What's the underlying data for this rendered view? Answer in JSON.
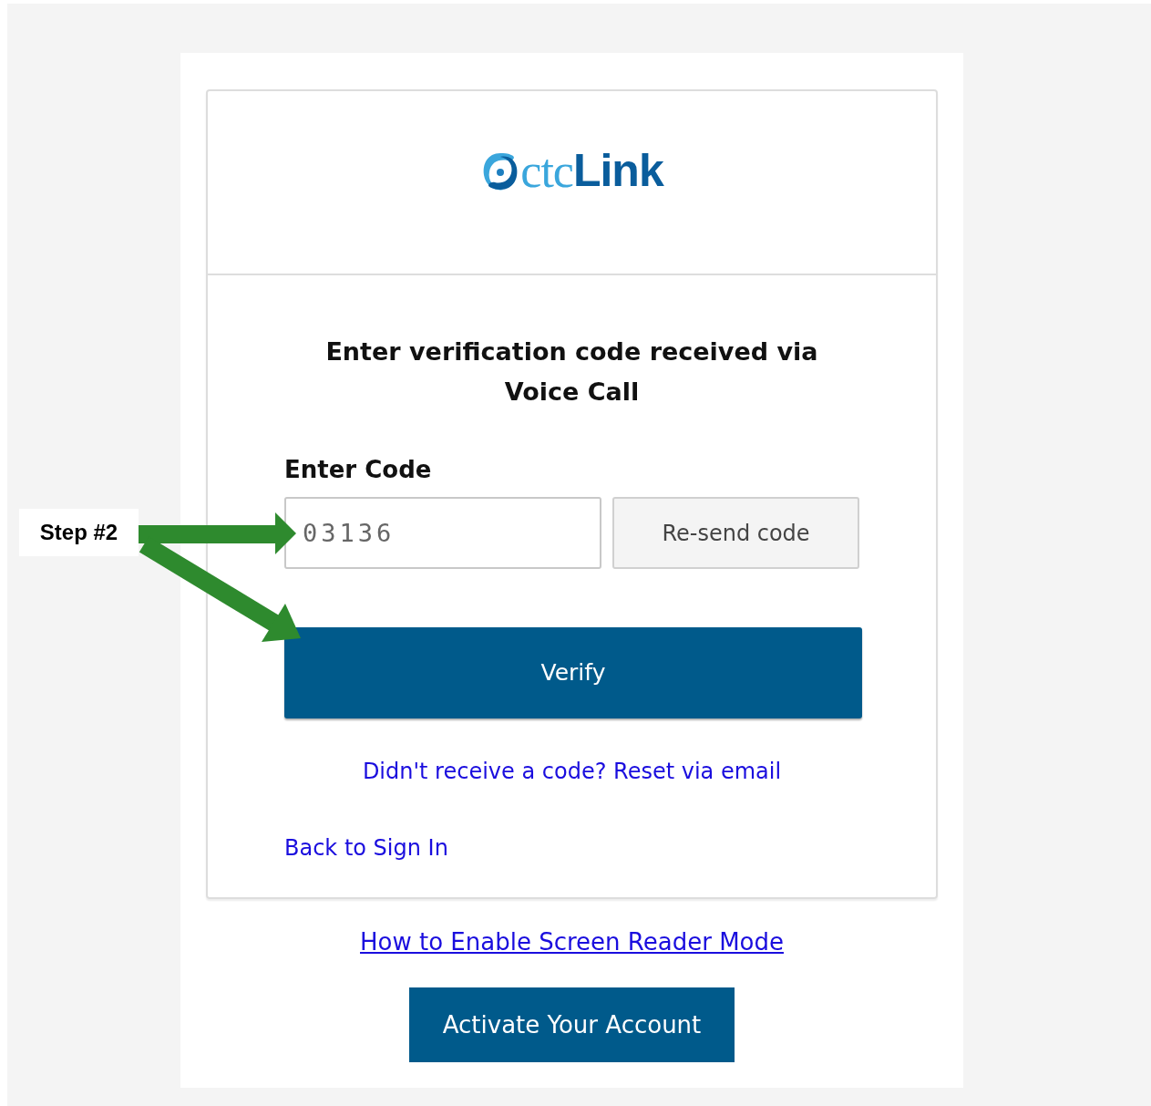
{
  "logo": {
    "light_text": "ctc",
    "bold_text": "Link"
  },
  "heading": "Enter verification code received via Voice Call",
  "code_field": {
    "label": "Enter Code",
    "value": "03136"
  },
  "resend_button": "Re-send code",
  "verify_button": "Verify",
  "reset_link": "Didn't receive a code? Reset via email",
  "back_link": "Back to Sign In",
  "screen_reader_link": "How to Enable Screen Reader Mode",
  "activate_button": "Activate Your Account",
  "annotation": {
    "label": "Step #2"
  }
}
